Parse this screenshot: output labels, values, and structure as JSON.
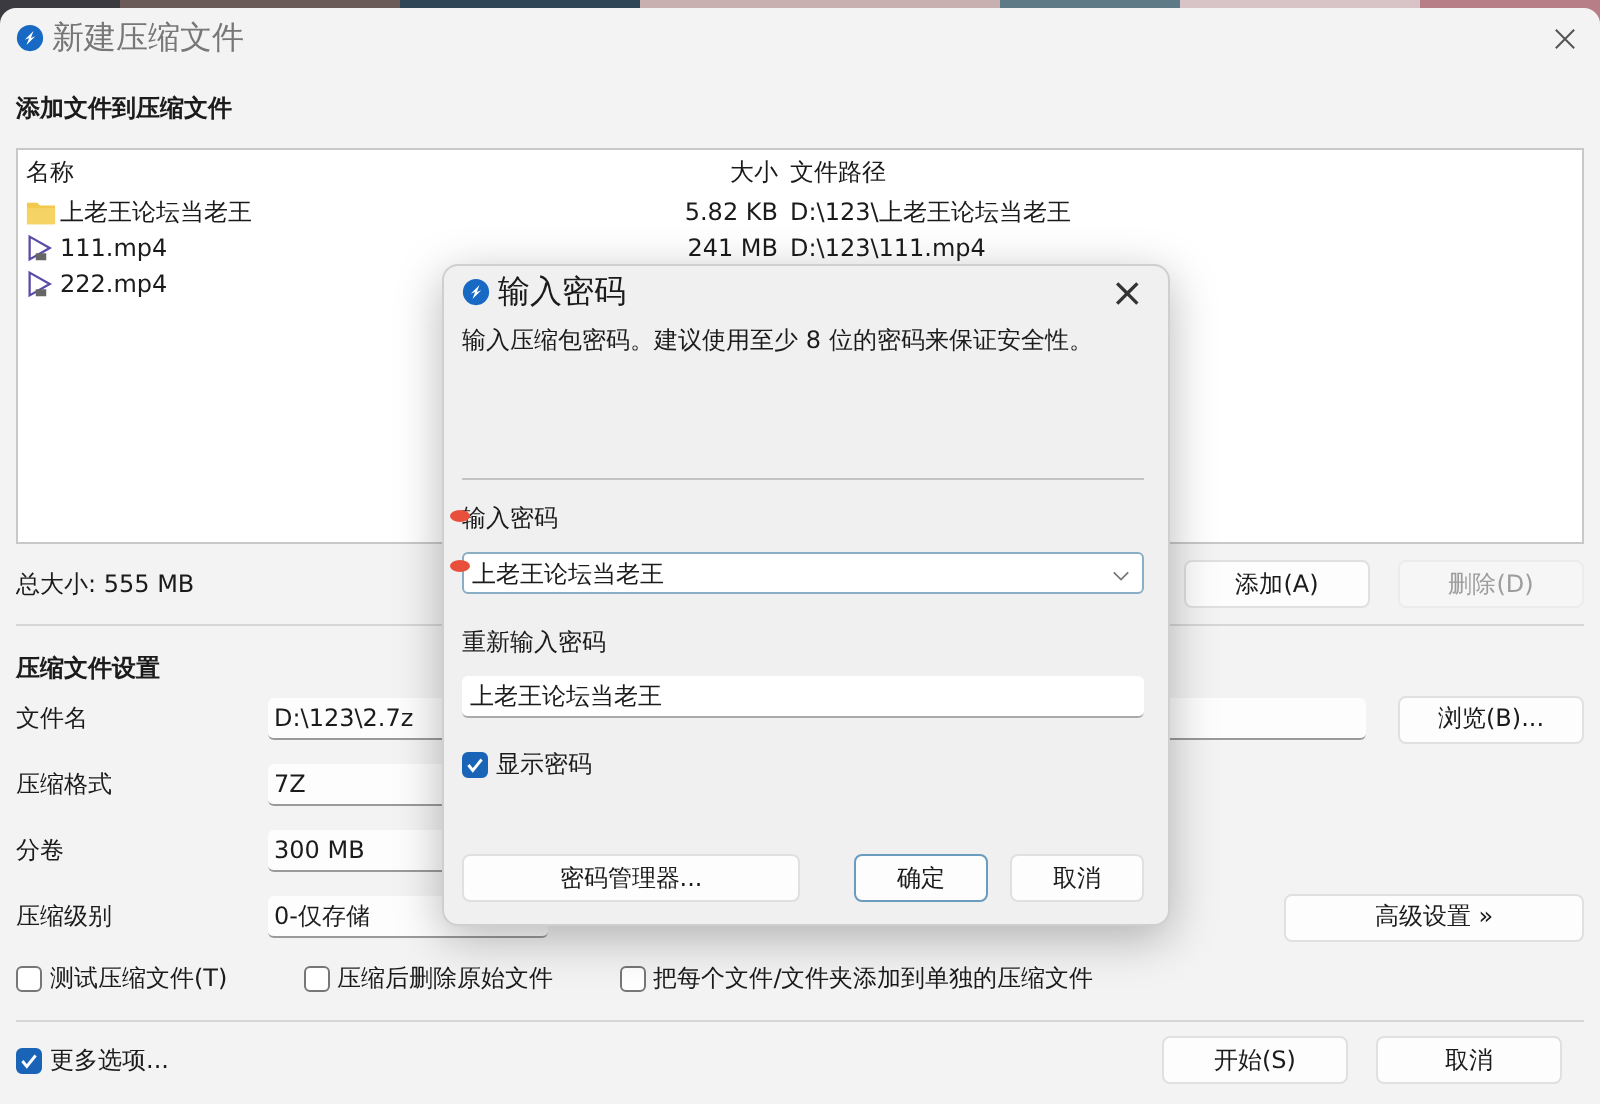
{
  "window": {
    "title": "新建压缩文件"
  },
  "files": {
    "heading": "添加文件到压缩文件",
    "columns": [
      "名称",
      "大小",
      "文件路径"
    ],
    "rows": [
      {
        "kind": "folder",
        "name": "上老王论坛当老王",
        "size": "5.82 KB",
        "path": "D:\\123\\上老王论坛当老王"
      },
      {
        "kind": "video",
        "name": "111.mp4",
        "size": "241 MB",
        "path": "D:\\123\\111.mp4"
      },
      {
        "kind": "video",
        "name": "222.mp4"
      }
    ]
  },
  "total_size": "总大小: 555 MB",
  "file_buttons": [
    {
      "label": "添加(A)",
      "disabled": false
    },
    {
      "label": "删除(D)",
      "disabled": true
    }
  ],
  "settings": {
    "heading": "压缩文件设置",
    "fields": [
      {
        "label": "文件名",
        "value": "D:\\123\\2.7z",
        "kind": "text",
        "button": "浏览(B)..."
      },
      {
        "label": "压缩格式",
        "value": "7Z",
        "kind": "box"
      },
      {
        "label": "分卷",
        "value": "300 MB",
        "kind": "box"
      },
      {
        "label": "压缩级别",
        "value": "0-仅存储",
        "kind": "select",
        "button": "高级设置 »"
      }
    ]
  },
  "options": [
    {
      "label": "测试压缩文件(T)",
      "checked": false
    },
    {
      "label": "压缩后删除原始文件",
      "checked": false
    },
    {
      "label": "把每个文件/文件夹添加到单独的压缩文件",
      "checked": false
    }
  ],
  "more_options": {
    "label": "更多选项...",
    "checked": true
  },
  "footer_buttons": [
    "开始(S)",
    "取消"
  ],
  "dialog": {
    "title": "输入密码",
    "close": "×",
    "description": "输入压缩包密码。建议使用至少 8 位的密码来保证安全性。",
    "password_label": "输入密码",
    "password": "上老王论坛当老王",
    "confirm_label": "重新输入密码",
    "confirm": "上老王论坛当老王",
    "show_password": {
      "label": "显示密码",
      "checked": true
    },
    "buttons": [
      {
        "label": "密码管理器...",
        "kind": "manager"
      },
      {
        "label": "确定",
        "kind": "default"
      },
      {
        "label": "取消",
        "kind": "normal"
      }
    ]
  }
}
